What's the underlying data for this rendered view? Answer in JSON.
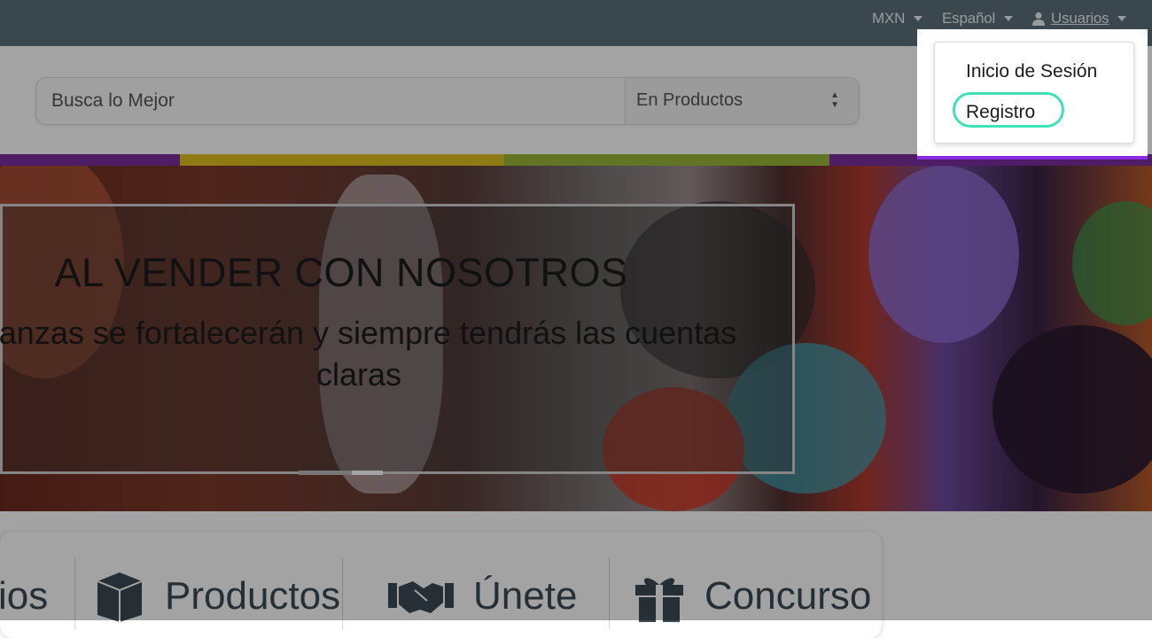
{
  "topbar": {
    "currency": "MXN",
    "language": "Español",
    "user_menu": "Usuarios",
    "user_icon": "user-icon",
    "bg_color": "#5b6f7a"
  },
  "search": {
    "placeholder": "Busca lo Mejor",
    "scope_selected": "En Productos",
    "button_icon": "search-icon"
  },
  "hero": {
    "title": "AL VENDER CON NOSOTROS",
    "subtitle_line1": "nanzas se fortalecerán y siempre tendrás las cuentas",
    "subtitle_line2": "claras"
  },
  "cards": [
    {
      "label": "ios",
      "icon": "unknown-partial"
    },
    {
      "label": "Productos",
      "icon": "box-icon"
    },
    {
      "label": "Únete",
      "icon": "handshake-icon"
    },
    {
      "label": "Concurso",
      "icon": "gift-icon"
    }
  ],
  "user_dropdown": {
    "items": [
      {
        "label": "Inicio de Sesión"
      },
      {
        "label": "Registro"
      }
    ],
    "highlight_color": "#3de3b6"
  },
  "stripe_colors": [
    "#7a2ea0",
    "#e0c020",
    "#9ab83a",
    "#7a2ea0"
  ],
  "accent_color": "#8a2be2"
}
